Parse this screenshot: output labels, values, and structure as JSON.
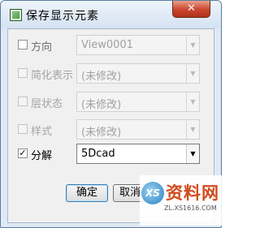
{
  "dialog": {
    "title": "保存显示元素",
    "close_label": "✕"
  },
  "options": [
    {
      "label": "方向",
      "checked": false,
      "enabled": true,
      "value": "View0001"
    },
    {
      "label": "简化表示",
      "checked": false,
      "enabled": false,
      "value": "(未修改)"
    },
    {
      "label": "层状态",
      "checked": false,
      "enabled": false,
      "value": "(未修改)"
    },
    {
      "label": "样式",
      "checked": false,
      "enabled": false,
      "value": "(未修改)"
    },
    {
      "label": "分解",
      "checked": true,
      "enabled": true,
      "value": "5Dcad"
    }
  ],
  "dropdown_arrow": "▼",
  "checkmark": "✓",
  "buttons": {
    "ok": "确定",
    "cancel": "取消"
  },
  "watermark": {
    "title": "资料网",
    "url": "ZL.XS1616.COM",
    "logo_text": "XS"
  }
}
